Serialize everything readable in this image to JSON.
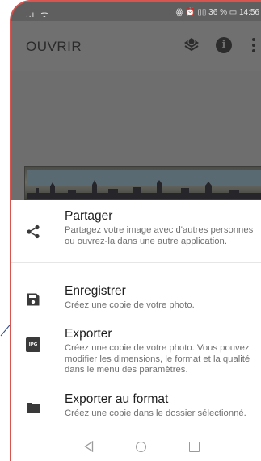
{
  "status": {
    "left": "..ıl ᯤ",
    "right": "ꙮ ⏰ ▯▯ 36 % ▭ 14:56"
  },
  "appbar": {
    "title": "OUVRIR",
    "icons": [
      "layers-icon",
      "info-icon",
      "more-vert-icon"
    ],
    "info_glyph": "i"
  },
  "sheet": {
    "items": [
      {
        "icon": "share-icon",
        "title": "Partager",
        "description": "Partagez votre image avec d'autres personnes ou ouvrez-la dans une autre application."
      },
      {
        "icon": "save-icon",
        "title": "Enregistrer",
        "description": "Créez une copie de votre photo."
      },
      {
        "icon": "jpg-icon",
        "icon_text": "JPG",
        "title": "Exporter",
        "description": "Créez une copie de votre photo. Vous pouvez modifier les dimensions, le format et la qualité dans le menu des paramètres."
      },
      {
        "icon": "folder-icon",
        "title": "Exporter au format",
        "description": "Créez une copie dans le dossier sélectionné."
      }
    ]
  },
  "navbar": {
    "buttons": [
      "back-icon",
      "home-icon",
      "recent-apps-icon"
    ]
  },
  "colors": {
    "scrim": "#6e6e6e",
    "sheet": "#ffffff",
    "annotation": "#d9534f"
  }
}
